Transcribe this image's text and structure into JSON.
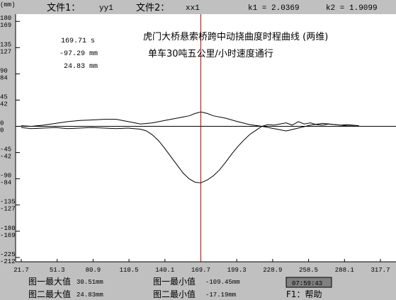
{
  "header": {
    "file1_label": "文件1：",
    "file1_value": "yy1",
    "file2_label": "文件2：",
    "file2_value": "xx1",
    "k1_text": "k1 = 2.0369",
    "k2_text": "k2 = 1.9099"
  },
  "y_unit": "(mm)",
  "annotations": {
    "time": "169.71 s",
    "value1": "-97.29 mm",
    "value2": "24.83 mm"
  },
  "footer": {
    "max1_label": "图一最大值",
    "max1_value": "30.51mm",
    "min1_label": "图一最小值",
    "min1_value": "-109.45mm",
    "max2_label": "图二最大值",
    "max2_value": "24.83mm",
    "min2_label": "图二最小值",
    "min2_value": "-17.19mm",
    "clock": "07:59:43",
    "help": "F1：帮助"
  },
  "colors": {
    "background": "#c0c0c0",
    "plot_bg": "#ffffff",
    "cursor": "#c00000",
    "trace": "#000000",
    "clock_bg": "#808080"
  },
  "chart_data": {
    "type": "line",
    "title": "虎门大桥悬索桥跨中动挠曲度时程曲线 (两维)",
    "subtitle": "单车30吨五公里/小时速度通行",
    "xlim": [
      21.7,
      317.7
    ],
    "x_ticks": [
      "21.7",
      "51.3",
      "80.9",
      "110.5",
      "140.1",
      "169.7",
      "199.3",
      "228.9",
      "258.5",
      "288.1",
      "317.7"
    ],
    "x_tick_values": [
      21.7,
      51.3,
      80.9,
      110.5,
      140.1,
      169.7,
      199.3,
      228.9,
      258.5,
      288.1,
      317.7
    ],
    "y_ticks_left_top": [
      "180",
      "135",
      "90",
      "45",
      "0",
      "-45",
      "-90",
      "-135",
      "-180",
      "-225"
    ],
    "y_ticks_left_bot": [
      "169",
      "127",
      "84",
      "42",
      "0",
      "-42",
      "-84",
      "-127",
      "-169",
      "-212"
    ],
    "y_tick_values_mm": [
      180,
      135,
      90,
      45,
      0,
      -45,
      -90,
      -135,
      -180,
      -225
    ],
    "ylim": [
      -230,
      190
    ],
    "cursor_x": 169.71,
    "series": [
      {
        "x": [
          21.7,
          30,
          40,
          50,
          60,
          70,
          80,
          90,
          100,
          110,
          120,
          125,
          130,
          135,
          140,
          145,
          150,
          155,
          160,
          165,
          169.7,
          175,
          180,
          185,
          190,
          195,
          200,
          205,
          210,
          215,
          220,
          225,
          230,
          235,
          240,
          245,
          250,
          255,
          260,
          265,
          270,
          275,
          280,
          285,
          290,
          295,
          300
        ],
        "y": [
          -2,
          -4,
          -3,
          -2,
          -4,
          -3,
          -2,
          -3,
          -4,
          -3,
          -5,
          -8,
          -15,
          -25,
          -38,
          -52,
          -66,
          -80,
          -90,
          -96,
          -97,
          -92,
          -85,
          -75,
          -62,
          -48,
          -35,
          -24,
          -14,
          -7,
          0,
          3,
          2,
          4,
          6,
          2,
          8,
          4,
          6,
          3,
          2,
          4,
          3,
          2,
          3,
          2,
          1
        ]
      },
      {
        "x": [
          21.7,
          30,
          40,
          50,
          60,
          70,
          80,
          90,
          100,
          110,
          120,
          130,
          140,
          150,
          160,
          165,
          169.7,
          175,
          180,
          190,
          200,
          210,
          220,
          230,
          240,
          250,
          260,
          270,
          280,
          290,
          300
        ],
        "y": [
          1,
          0,
          2,
          5,
          8,
          10,
          11,
          12,
          12,
          8,
          4,
          6,
          10,
          14,
          18,
          22,
          24.8,
          22,
          18,
          14,
          8,
          3,
          0,
          -4,
          -8,
          -3,
          2,
          5,
          3,
          1,
          0
        ]
      }
    ]
  }
}
